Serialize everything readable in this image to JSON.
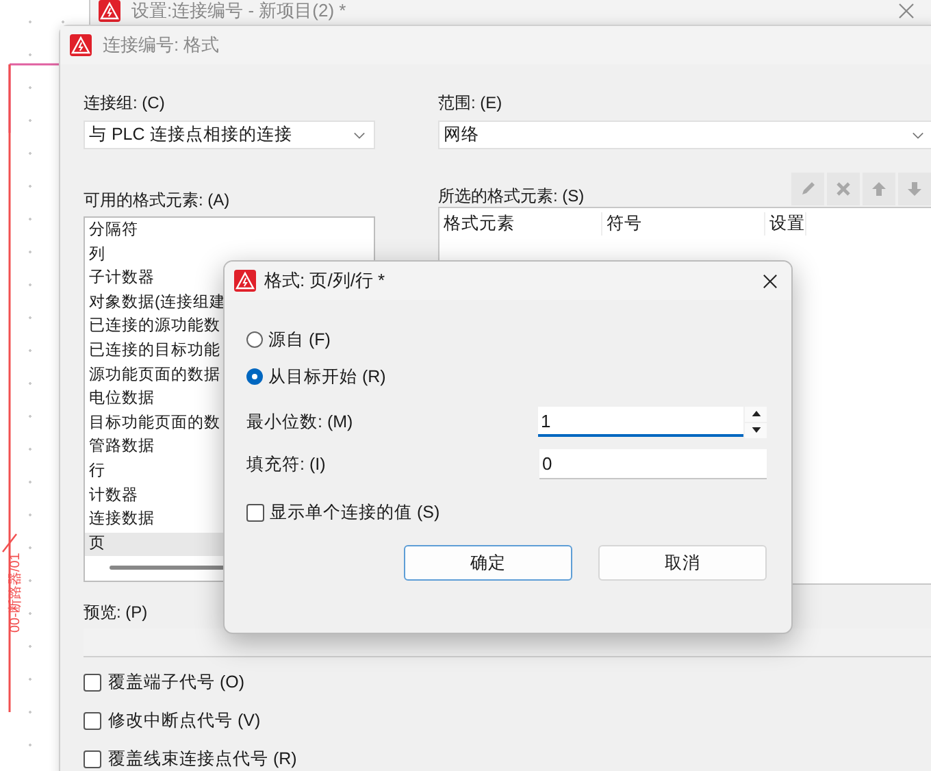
{
  "canvas": {
    "label": "00-断路器/01"
  },
  "back_window": {
    "title": "设置:连接编号 - 新项目(2) *"
  },
  "window": {
    "title": "连接编号: 格式",
    "connection_group": {
      "label": "连接组: (C)",
      "value": "与 PLC 连接点相接的连接"
    },
    "scope": {
      "label": "范围: (E)",
      "value": "网络"
    },
    "available": {
      "label": "可用的格式元素: (A)",
      "items": [
        {
          "text": "分隔符",
          "selected": false
        },
        {
          "text": "列",
          "selected": false
        },
        {
          "text": "子计数器",
          "selected": false
        },
        {
          "text": "对象数据(连接组建",
          "selected": false
        },
        {
          "text": "已连接的源功能数",
          "selected": false
        },
        {
          "text": "已连接的目标功能",
          "selected": false
        },
        {
          "text": "源功能页面的数据",
          "selected": false
        },
        {
          "text": "电位数据",
          "selected": false
        },
        {
          "text": "目标功能页面的数",
          "selected": false
        },
        {
          "text": "管路数据",
          "selected": false
        },
        {
          "text": "行",
          "selected": false
        },
        {
          "text": "计数器",
          "selected": false
        },
        {
          "text": "连接数据",
          "selected": false
        },
        {
          "text": "页",
          "selected": true
        }
      ]
    },
    "selected_elements": {
      "label": "所选的格式元素: (S)",
      "tools": [
        {
          "kind": "edit",
          "disabled": true
        },
        {
          "kind": "delete",
          "disabled": true
        },
        {
          "kind": "up",
          "disabled": true
        },
        {
          "kind": "down",
          "disabled": true
        }
      ],
      "columns": [
        "格式元素",
        "符号",
        "设置"
      ]
    },
    "preview": {
      "label": "预览: (P)"
    },
    "options": [
      {
        "label": "覆盖端子代号 (O)",
        "checked": false
      },
      {
        "label": "修改中断点代号 (V)",
        "checked": false
      },
      {
        "label": "覆盖线束连接点代号 (R)",
        "checked": false
      }
    ]
  },
  "dialog": {
    "title": "格式: 页/列/行 *",
    "radios": [
      {
        "label": "源自 (F)",
        "selected": false
      },
      {
        "label": "从目标开始 (R)",
        "selected": true
      }
    ],
    "min_digits": {
      "label": "最小位数: (M)",
      "value": "1"
    },
    "fill": {
      "label": "填充符: (I)",
      "value": "0"
    },
    "show_single": {
      "label": "显示单个连接的值 (S)",
      "checked": false
    },
    "buttons": [
      {
        "label": "确定",
        "default": true
      },
      {
        "label": "取消",
        "default": false
      }
    ]
  }
}
